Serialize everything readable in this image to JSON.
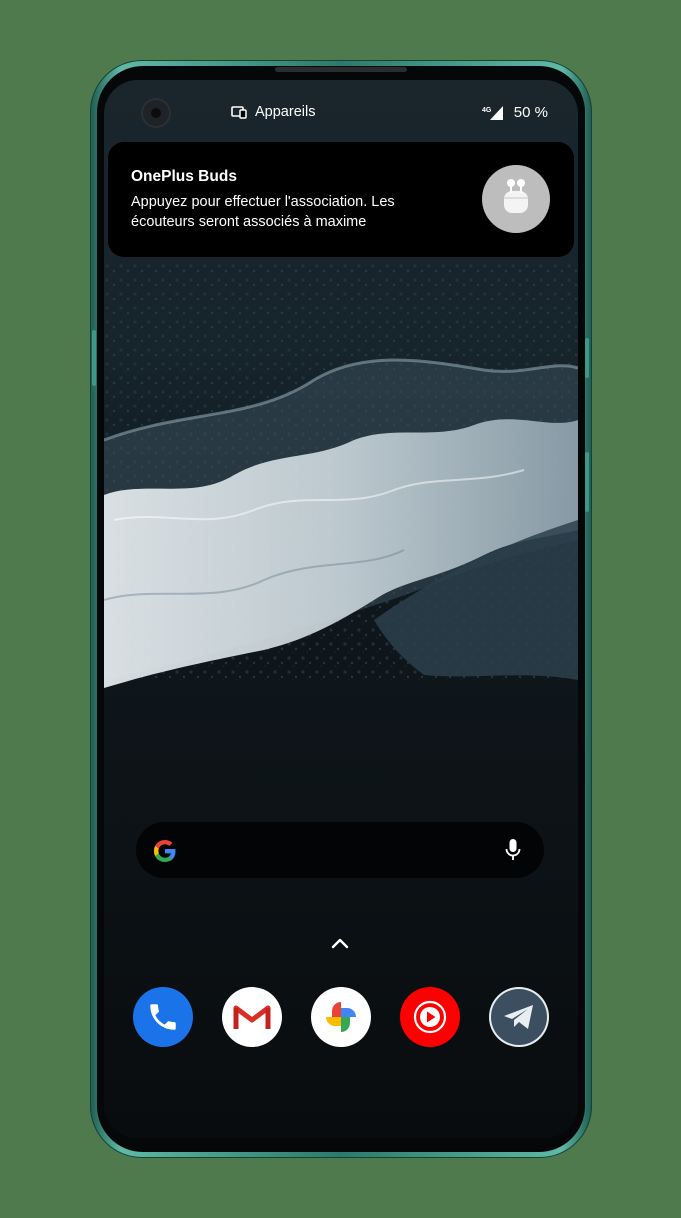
{
  "status_bar": {
    "devices_label": "Appareils",
    "network_label": "4G",
    "battery_label": "50 %"
  },
  "notification": {
    "title": "OnePlus Buds",
    "line1": "Appuyez pour effectuer l'association. Les",
    "line2": "écouteurs seront associés à maxime",
    "image": "earbuds-case-icon"
  },
  "search": {
    "logo": "google-g-icon",
    "mic": "microphone-icon"
  },
  "app_drawer_hint": "chevron-up-icon",
  "dock": {
    "apps": [
      "Phone",
      "Gmail",
      "Google Photos",
      "YouTube Music",
      "Telegram"
    ]
  },
  "colors": {
    "frame": "#3d9886",
    "phone_blue": "#1a73e8",
    "yt_red": "#ff0000",
    "telegram_bg": "#3b4f61"
  }
}
